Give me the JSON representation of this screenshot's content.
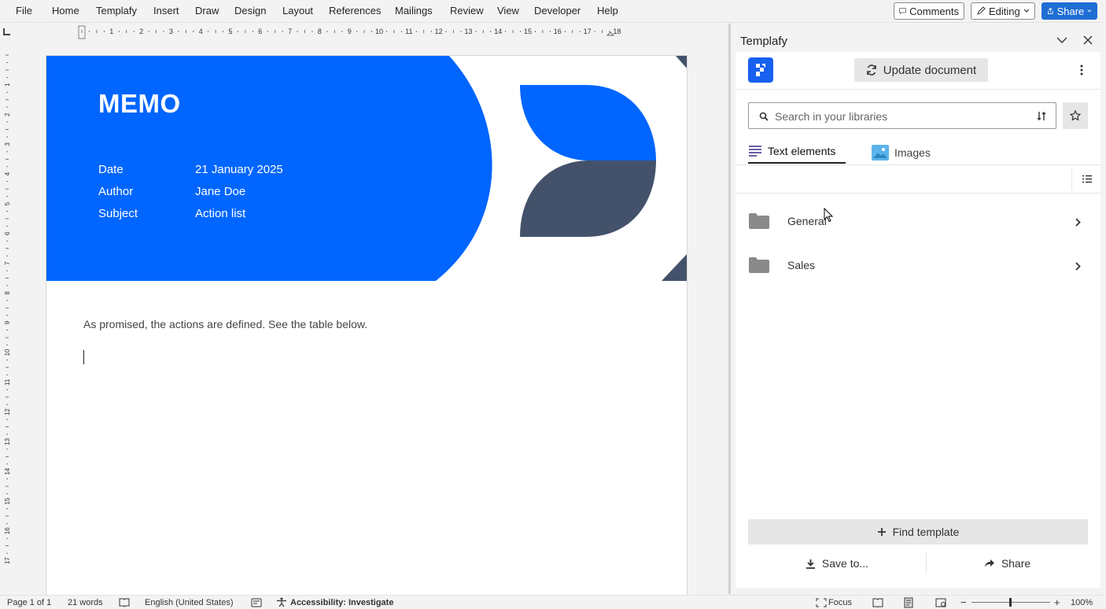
{
  "menu": [
    "File",
    "Home",
    "Templafy",
    "Insert",
    "Draw",
    "Design",
    "Layout",
    "References",
    "Mailings",
    "Review",
    "View",
    "Developer",
    "Help"
  ],
  "top_buttons": {
    "comments": "Comments",
    "editing": "Editing",
    "share": "Share"
  },
  "ruler_numbers": [
    "1",
    "2",
    "3",
    "4",
    "5",
    "6",
    "7",
    "8",
    "9",
    "10",
    "11",
    "12",
    "13",
    "14",
    "15",
    "16",
    "17",
    "18"
  ],
  "document": {
    "title": "MEMO",
    "fields": [
      {
        "label": "Date",
        "value": "21 January 2025"
      },
      {
        "label": "Author",
        "value": "Jane Doe"
      },
      {
        "label": "Subject",
        "value": "Action list"
      }
    ],
    "body": "As promised, the actions are defined. See the table below.",
    "colors": {
      "hero_blue": "#0066ff",
      "shape_dark": "#43526a"
    }
  },
  "pane": {
    "title": "Templafy",
    "update_label": "Update document",
    "search_placeholder": "Search in your libraries",
    "tabs": [
      {
        "label": "Text elements"
      },
      {
        "label": "Images"
      }
    ],
    "folders": [
      {
        "label": "General"
      },
      {
        "label": "Sales"
      }
    ],
    "find_label": "Find template",
    "save_label": "Save to...",
    "share_label": "Share"
  },
  "status": {
    "page": "Page 1 of 1",
    "words": "21 words",
    "language": "English (United States)",
    "accessibility": "Accessibility: Investigate",
    "focus": "Focus",
    "zoom": "100%"
  }
}
